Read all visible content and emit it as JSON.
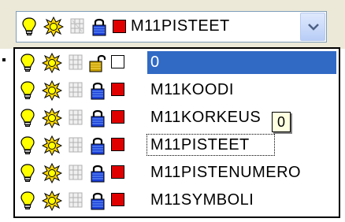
{
  "combo": {
    "selected_label": "M11PISTEET",
    "color": "#e00000",
    "icons": [
      "lightbulb-icon",
      "sun-icon",
      "grid-icon",
      "lock-icon"
    ]
  },
  "dropdown": {
    "items": [
      {
        "label": "0",
        "locked": false,
        "color": "#ffffff",
        "selected": true
      },
      {
        "label": "M11KOODI",
        "locked": true,
        "color": "#e00000",
        "selected": false
      },
      {
        "label": "M11KORKEUS",
        "locked": true,
        "color": "#e00000",
        "selected": false
      },
      {
        "label": "M11PISTEET",
        "locked": true,
        "color": "#e00000",
        "selected": false,
        "focused": true
      },
      {
        "label": "M11PISTENUMERO",
        "locked": true,
        "color": "#e00000",
        "selected": false
      },
      {
        "label": "M11SYMBOLI",
        "locked": true,
        "color": "#e00000",
        "selected": false
      }
    ]
  },
  "tooltip": {
    "text": "0"
  },
  "colors": {
    "selection": "#316ac5",
    "tooltip_bg": "#ffffe1",
    "combo_border": "#7f9db9",
    "toolbar_bg": "#ece9d8"
  }
}
